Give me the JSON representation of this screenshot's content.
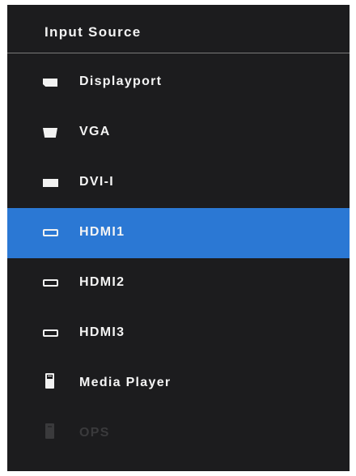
{
  "header": {
    "title": "Input Source"
  },
  "menu": {
    "items": [
      {
        "label": "Displayport",
        "icon": "displayport-icon",
        "state": "normal"
      },
      {
        "label": "VGA",
        "icon": "vga-icon",
        "state": "normal"
      },
      {
        "label": "DVI-I",
        "icon": "dvi-icon",
        "state": "normal"
      },
      {
        "label": "HDMI1",
        "icon": "hdmi-icon",
        "state": "selected"
      },
      {
        "label": "HDMI2",
        "icon": "hdmi-icon",
        "state": "normal"
      },
      {
        "label": "HDMI3",
        "icon": "hdmi-icon",
        "state": "normal"
      },
      {
        "label": "Media Player",
        "icon": "usb-stick-icon",
        "state": "normal"
      },
      {
        "label": "OPS",
        "icon": "ops-icon",
        "state": "disabled"
      }
    ]
  },
  "colors": {
    "background": "#1c1c1e",
    "selection": "#2b78d4",
    "text": "#f4f4f4",
    "disabled_text": "#3a3a3c",
    "divider": "#7a7a7a"
  }
}
